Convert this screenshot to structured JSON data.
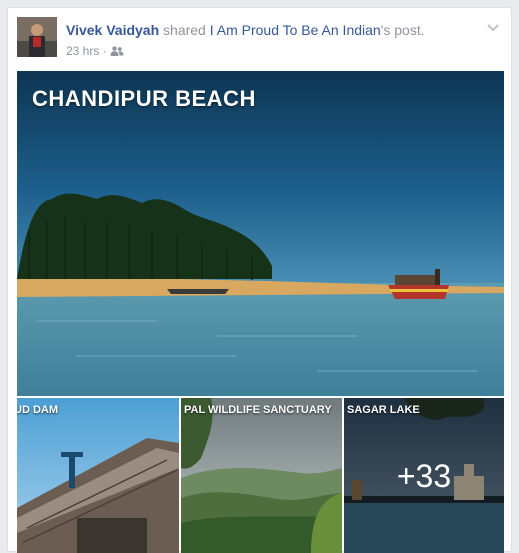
{
  "post": {
    "author": "Vivek Vaidyah",
    "action": "shared",
    "page_name": "I Am Proud To Be An Indian",
    "object_suffix": "'s post.",
    "timestamp": "23 hrs",
    "separator": "·",
    "audience_icon": "friends-icon",
    "menu_icon": "chevron-down-icon"
  },
  "photos": {
    "main": {
      "title": "CHANDIPUR BEACH"
    },
    "thumbs": [
      {
        "label": "UD DAM"
      },
      {
        "label": "PAL WILDLIFE SANCTUARY"
      },
      {
        "label": "SAGAR LAKE"
      }
    ],
    "more_count": "+33"
  },
  "colors": {
    "link": "#365899",
    "meta_text": "#90949c",
    "sky": "#1c5f8c",
    "water": "#4d90a8",
    "sand": "#d8a860"
  }
}
